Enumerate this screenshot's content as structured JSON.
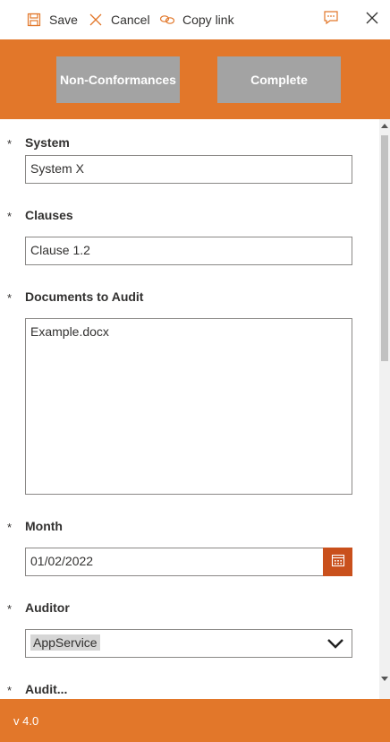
{
  "toolbar": {
    "save_label": "Save",
    "cancel_label": "Cancel",
    "copy_link_label": "Copy link"
  },
  "header": {
    "non_conformances_label": "Non-Conformances",
    "complete_label": "Complete"
  },
  "form": {
    "required_marker": "*",
    "system": {
      "label": "System",
      "value": "System X"
    },
    "clauses": {
      "label": "Clauses",
      "value": "Clause 1.2"
    },
    "documents": {
      "label": "Documents to Audit",
      "value": "Example.docx"
    },
    "month": {
      "label": "Month",
      "value": "01/02/2022"
    },
    "auditor": {
      "label": "Auditor",
      "value": "AppService"
    },
    "next_label": "Audit..."
  },
  "footer": {
    "version": "v 4.0"
  },
  "colors": {
    "accent": "#e2772a",
    "date_button": "#c9501c",
    "header_button": "#a3a3a3"
  },
  "icons": [
    "save-icon",
    "cancel-icon",
    "link-icon",
    "comment-icon",
    "close-icon",
    "calendar-icon",
    "chevron-down-icon"
  ]
}
